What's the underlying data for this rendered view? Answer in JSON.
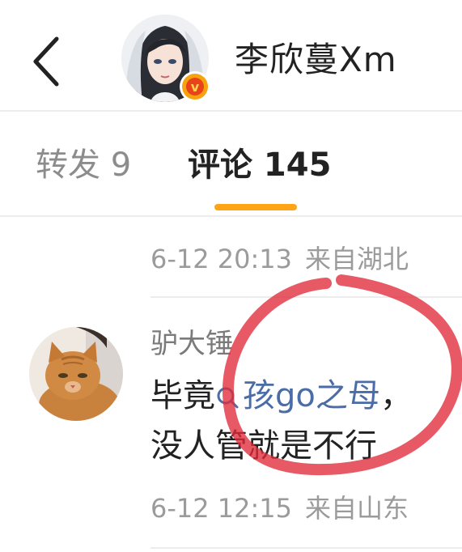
{
  "header": {
    "username": "李欣蔓Xm",
    "verified_badge_letter": "v"
  },
  "tabs": [
    {
      "label": "转发 9",
      "active": false
    },
    {
      "label": "评论 145",
      "active": true
    }
  ],
  "comments": [
    {
      "date": "6-12 20:13",
      "location": "来自湖北"
    },
    {
      "username": "驴大锤",
      "text_prefix": "毕竟",
      "topic": "孩go之母",
      "text_after_topic": "，",
      "text_line2": "没人管就是不行",
      "date": "6-12 12:15",
      "location": "来自山东"
    }
  ],
  "colors": {
    "accent_orange": "#ffa317",
    "link_blue": "#4a6da7",
    "annotation_red": "#e02a3a"
  },
  "icons": {
    "back": "chevron-left-icon",
    "topic": "search-icon",
    "verified": "verified-v-icon"
  }
}
